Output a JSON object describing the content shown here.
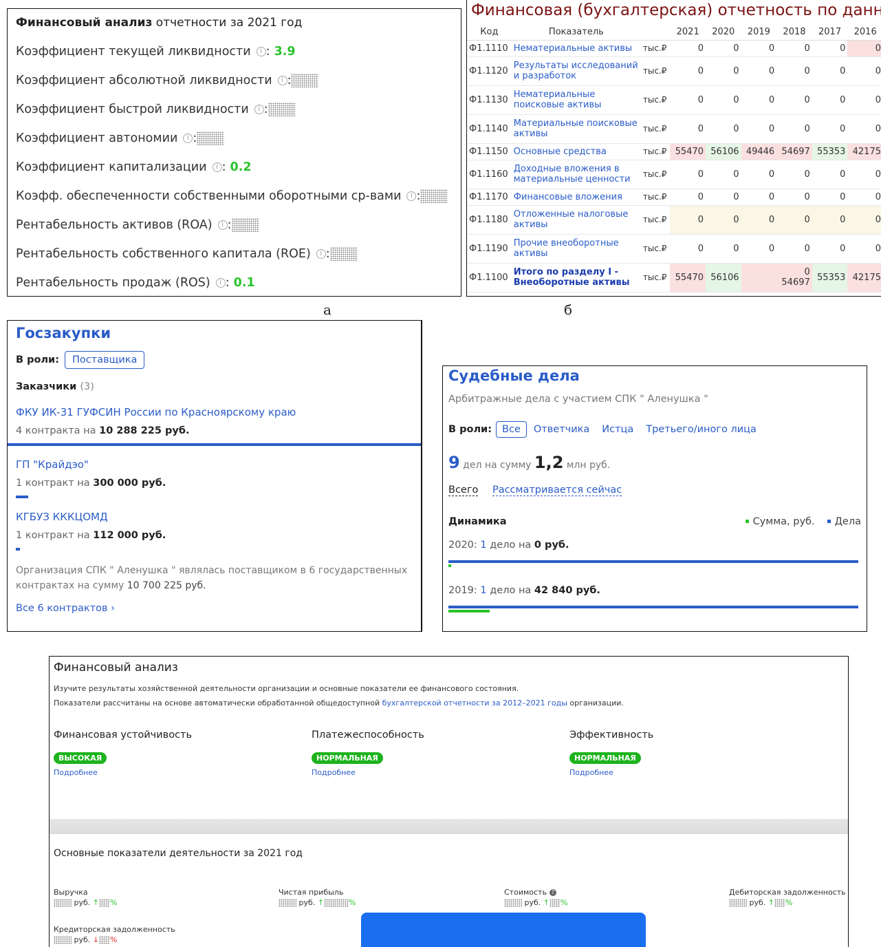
{
  "captions": {
    "a": "а",
    "b": "б"
  },
  "ratios": {
    "title_bold": "Финансовый анализ",
    "title_rest": " отчетности за 2021 год",
    "info_glyph": "i",
    "colon": ":",
    "rows": [
      {
        "label": "Коэффициент текущей ликвидности",
        "value": "3.9"
      },
      {
        "label": "Коэффициент абсолютной ликвидности",
        "value": null
      },
      {
        "label": "Коэффициент быстрой ликвидности",
        "value": null
      },
      {
        "label": "Коэффициент автономии",
        "value": null
      },
      {
        "label": "Коэффициент капитализации",
        "value": "0.2"
      },
      {
        "label": "Коэфф. обеспеченности собственными оборотными ср-вами",
        "value": null
      },
      {
        "label": "Рентабельность активов (ROA)",
        "value": null
      },
      {
        "label": "Рентабельность собственного капитала (ROE)",
        "value": null
      },
      {
        "label": "Рентабельность продаж (ROS)",
        "value": "0.1"
      }
    ]
  },
  "statements": {
    "title": "Финансовая (бухгалтерская) отчетность по данны",
    "headers": [
      "Код",
      "Показатель",
      "",
      "2021",
      "2020",
      "2019",
      "2018",
      "2017",
      "2016"
    ],
    "rows": [
      {
        "code": "Ф1.1110",
        "name": "Нематериальные активы",
        "unit": "тыс.₽",
        "values": [
          "0",
          "0",
          "0",
          "0",
          "0",
          "0"
        ],
        "tones": [
          "",
          "",
          "",
          "",
          "",
          "pink"
        ],
        "single": true
      },
      {
        "code": "Ф1.1120",
        "name": "Результаты исследований и разработок",
        "unit": "тыс.₽",
        "values": [
          "0",
          "0",
          "0",
          "0",
          "0",
          "0"
        ],
        "tones": [
          "",
          "",
          "",
          "",
          "",
          ""
        ]
      },
      {
        "code": "Ф1.1130",
        "name": "Нематериальные поисковые активы",
        "unit": "тыс.₽",
        "values": [
          "0",
          "0",
          "0",
          "0",
          "0",
          "0"
        ],
        "tones": [
          "",
          "",
          "",
          "",
          "",
          ""
        ]
      },
      {
        "code": "Ф1.1140",
        "name": "Материальные поисковые активы",
        "unit": "тыс.₽",
        "values": [
          "0",
          "0",
          "0",
          "0",
          "0",
          "0"
        ],
        "tones": [
          "",
          "",
          "",
          "",
          "",
          ""
        ]
      },
      {
        "code": "Ф1.1150",
        "name": "Основные средства",
        "unit": "тыс.₽",
        "values": [
          "55470",
          "56106",
          "49446",
          "54697",
          "55353",
          "42175"
        ],
        "tones": [
          "pink",
          "lgreen",
          "pink",
          "pink",
          "lgreen",
          "pink"
        ],
        "single": true
      },
      {
        "code": "Ф1.1160",
        "name": "Доходные вложения в материальные ценности",
        "unit": "тыс.₽",
        "values": [
          "0",
          "0",
          "0",
          "0",
          "0",
          "0"
        ],
        "tones": [
          "",
          "",
          "",
          "",
          "",
          ""
        ]
      },
      {
        "code": "Ф1.1170",
        "name": "Финансовые вложения",
        "unit": "тыс.₽",
        "values": [
          "0",
          "0",
          "0",
          "0",
          "0",
          "0"
        ],
        "tones": [
          "",
          "",
          "",
          "",
          "",
          ""
        ],
        "single": true
      },
      {
        "code": "Ф1.1180",
        "name": "Отложенные налоговые активы",
        "unit": "тыс.₽",
        "values": [
          "0",
          "0",
          "0",
          "0",
          "0",
          "0"
        ],
        "tones": [
          "lyellow",
          "lyellow",
          "lyellow",
          "lyellow",
          "lyellow",
          "lyellow"
        ]
      },
      {
        "code": "Ф1.1190",
        "name": "Прочие внеоборотные активы",
        "unit": "тыс.₽",
        "values": [
          "0",
          "0",
          "0",
          "0",
          "0",
          "0"
        ],
        "tones": [
          "",
          "",
          "",
          "",
          "",
          ""
        ]
      },
      {
        "code": "Ф1.1100",
        "name": "Итого по разделу I - Внеоборотные активы",
        "unit": "тыс.₽",
        "values": [
          "55470",
          "56106",
          "",
          "0 54697",
          "55353",
          "42175"
        ],
        "tones": [
          "pink",
          "lgreen",
          "pink",
          "pink",
          "lgreen",
          "pink"
        ],
        "total": true
      }
    ]
  },
  "procurement": {
    "title": "Госзакупки",
    "role_label": "В роли:",
    "role_value": "Поставщика",
    "customers_label": "Заказчики",
    "customers_count": "(3)",
    "customers": [
      {
        "name": "ФКУ ИК-31 ГУФСИН России по Красноярскому краю",
        "info": "4 контракта на ",
        "amount": "10 288 225 руб.",
        "share": 1.0
      },
      {
        "name": "ГП \"Крайдэо\"",
        "info": "1 контракт на ",
        "amount": "300 000 руб.",
        "share": 0.03
      },
      {
        "name": "КГБУЗ КККЦОМД",
        "info": "1 контракт на ",
        "amount": "112 000 руб.",
        "share": 0.011
      }
    ],
    "note_a": "Организация СПК \" Аленушка \" являлась поставщиком в 6 государственных контрактах на сумму ",
    "note_amount": "10 700 225 руб.",
    "all_link": "Все 6 контрактов  ›"
  },
  "court": {
    "title": "Судебные дела",
    "subtitle": "Арбитражные дела с участием СПК \" Аленушка \"",
    "role_label": "В роли:",
    "roles": [
      "Все",
      "Ответчика",
      "Истца",
      "Третьего/иного лица"
    ],
    "count": "9",
    "count_text": " дел на сумму ",
    "sum": "1,2",
    "sum_unit": " млн руб.",
    "tab_all": "Всего",
    "tab_now": "Рассматривается сейчас",
    "dynamics": "Динамика",
    "legend_sum": "Сумма, руб.",
    "legend_cases": "Дела",
    "years": [
      {
        "year": "2020:",
        "cases": "1",
        "text": " дело на ",
        "amount": "0 руб.",
        "case_share": 1.0,
        "sum_share": 0.0
      },
      {
        "year": "2019:",
        "cases": "1",
        "text": " дело на ",
        "amount": "42 840 руб.",
        "case_share": 1.0,
        "sum_share": 0.1
      }
    ],
    "colors": {
      "sum": "#2bc32b",
      "cases": "#2a5cc8"
    }
  },
  "analysis": {
    "title": "Финансовый анализ",
    "text1": "Изучите результаты хозяйственной деятельности организации и основные показатели ее финансового состояния.",
    "text2_a": "Показатели рассчитаны на основе автоматически обработанной общедоступной ",
    "text2_link": "бухгалтерской отчетности за 2012–2021 годы",
    "text2_b": " организации.",
    "cols": [
      {
        "label": "Финансовая устойчивость",
        "badge": "ВЫСОКАЯ",
        "more": "Подробнее"
      },
      {
        "label": "Платежеспособность",
        "badge": "НОРМАЛЬНАЯ",
        "more": "Подробнее"
      },
      {
        "label": "Эффективность",
        "badge": "НОРМАЛЬНАЯ",
        "more": "Подробнее"
      }
    ],
    "section": "Основные показатели деятельности за 2021 год",
    "metrics": [
      {
        "label": "Выручка",
        "unit": " руб. ",
        "dir": "↑",
        "pct": "%"
      },
      {
        "label": "Чистая прибыль",
        "unit": " руб. ",
        "dir": "↑",
        "pct": "%"
      },
      {
        "label": "Стоимость",
        "unit": " руб. ",
        "dir": "↑",
        "pct": "%"
      },
      {
        "label": "Дебиторская задолженность",
        "unit": " руб. ",
        "dir": "↑",
        "pct": "%"
      },
      {
        "label": "Кредиторская задолженность",
        "unit": " руб. ",
        "dir": "↓",
        "pct": "%"
      }
    ],
    "q_glyph": "?"
  }
}
